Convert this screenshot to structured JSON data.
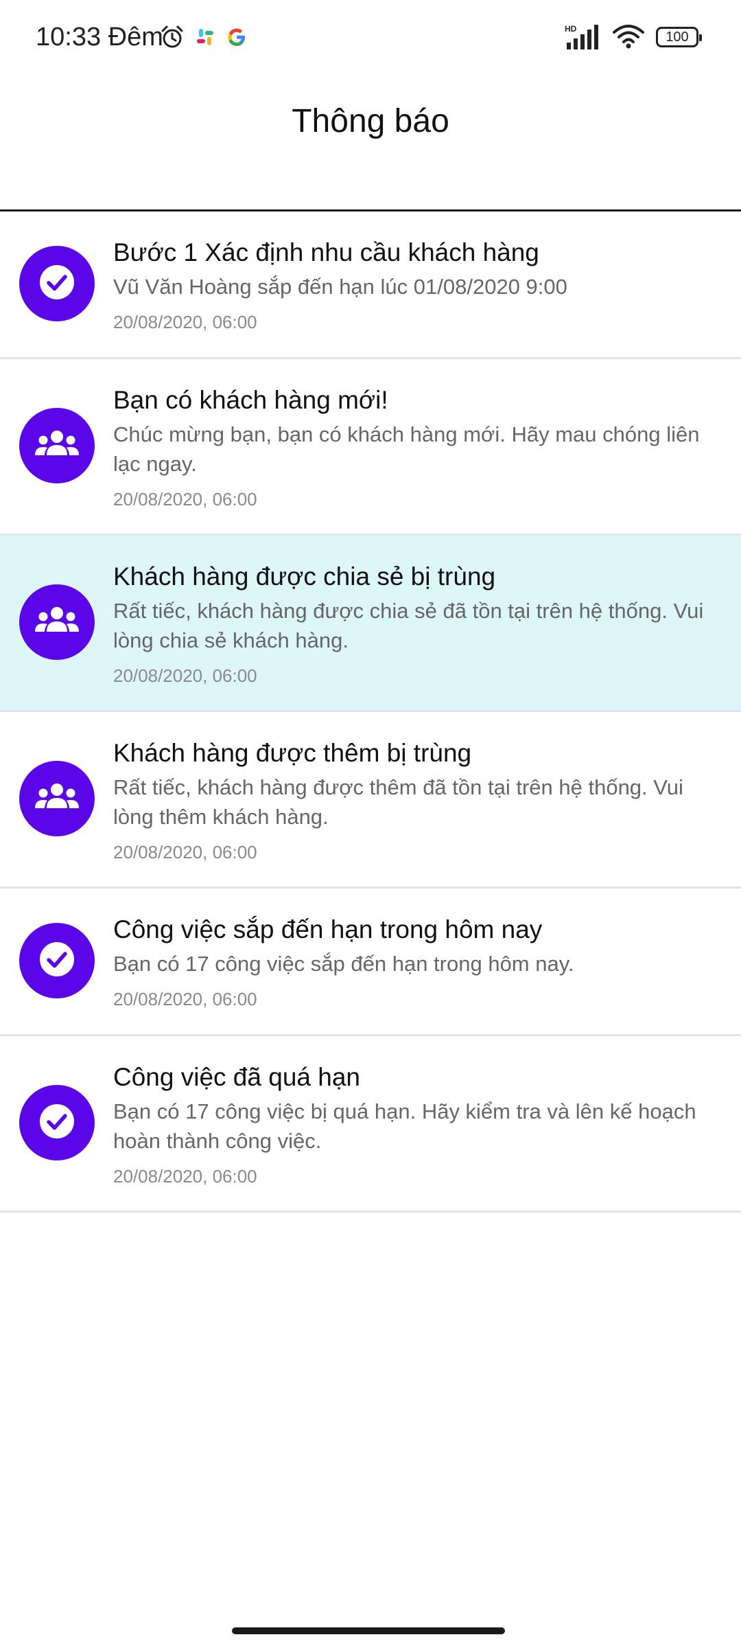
{
  "status_bar": {
    "time": "10:33 Đêm",
    "battery": "100",
    "icons": [
      "alarm-icon",
      "slack-icon",
      "google-icon",
      "hd-signal-icon",
      "wifi-icon",
      "battery-icon"
    ]
  },
  "header": {
    "title": "Thông báo"
  },
  "colors": {
    "accent": "#5b06e8",
    "highlight": "#ddf6f8"
  },
  "notifications": [
    {
      "icon": "check-icon",
      "title": "Bước 1 Xác định nhu cầu khách hàng",
      "body": "Vũ Văn Hoàng sắp đến hạn lúc 01/08/2020 9:00",
      "time": "20/08/2020, 06:00",
      "highlighted": false
    },
    {
      "icon": "group-icon",
      "title": "Bạn có khách hàng mới!",
      "body": "Chúc mừng bạn, bạn có khách hàng mới. Hãy mau chóng liên lạc ngay.",
      "time": "20/08/2020, 06:00",
      "highlighted": false
    },
    {
      "icon": "group-icon",
      "title": "Khách hàng được chia sẻ bị trùng",
      "body": "Rất tiếc, khách hàng được chia sẻ đã tồn tại trên hệ thống. Vui lòng chia sẻ khách hàng.",
      "time": "20/08/2020, 06:00",
      "highlighted": true
    },
    {
      "icon": "group-icon",
      "title": "Khách hàng được thêm bị trùng",
      "body": "Rất tiếc, khách hàng được thêm đã tồn tại trên hệ thống. Vui lòng thêm khách hàng.",
      "time": "20/08/2020, 06:00",
      "highlighted": false
    },
    {
      "icon": "check-icon",
      "title": "Công việc sắp đến hạn trong hôm nay",
      "body": "Bạn có 17 công việc sắp đến hạn trong hôm nay.",
      "time": "20/08/2020, 06:00",
      "highlighted": false
    },
    {
      "icon": "check-icon",
      "title": "Công việc đã quá hạn",
      "body": "Bạn có 17 công việc bị quá hạn. Hãy kiểm tra và lên kế hoạch hoàn thành công việc.",
      "time": "20/08/2020, 06:00",
      "highlighted": false
    }
  ]
}
